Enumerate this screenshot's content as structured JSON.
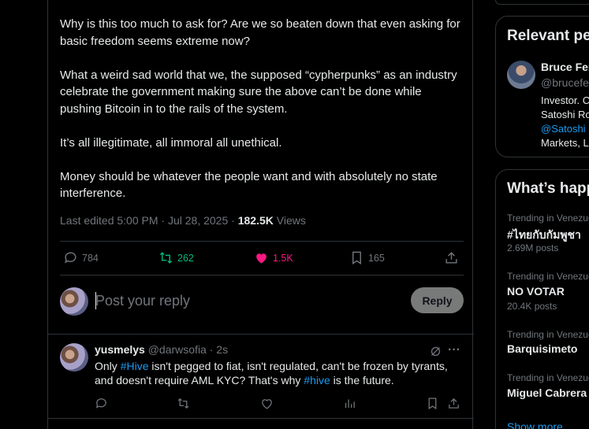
{
  "post": {
    "paragraphs": [
      "Why is this too much to ask for?  Are we so beaten down that even asking for basic freedom seems extreme now?",
      "What a weird sad world that we, the supposed “cypherpunks” as an industry celebrate the government making sure the above can’t be done while pushing Bitcoin in to the rails of the system.",
      "It’s all illegitimate, all immoral all unethical.",
      "Money should be whatever the people want and with absolutely no state interference."
    ],
    "meta": {
      "edited": "Last edited 5:00 PM · Jul 28, 2025 · ",
      "views_count": "182.5K",
      "views_label": " Views"
    },
    "actions": {
      "replies": "784",
      "reposts": "262",
      "likes": "1.5K",
      "bookmarks": "165"
    },
    "colors": {
      "repost": "#00ba7c",
      "like": "#f91880",
      "link": "#1d9bf0"
    }
  },
  "reply_box": {
    "placeholder": "Post your reply",
    "button": "Reply"
  },
  "comment": {
    "name": "yusmelys",
    "handle": " @darwsofia · 2s",
    "text_1": "Only ",
    "tag_1": "#Hive",
    "text_2": " isn't pegged to fiat, isn't regulated, can't be frozen by tyrants, and doesn't require AML KYC? That's why ",
    "tag_2": "#hive",
    "text_3": " is the future."
  },
  "sidebar": {
    "relevant": {
      "title": "Relevant pe",
      "name": "Bruce Fen",
      "handle": "@brucefen",
      "bio_lines": [
        "Investor. C",
        "Satoshi Ro",
        "@Satoshi",
        "Markets, L"
      ]
    },
    "trends": {
      "title": "What’s happ",
      "items": [
        {
          "meta": "Trending in Venezue",
          "name": "#ไทยกับกัมพูชา",
          "posts": "2.69M posts"
        },
        {
          "meta": "Trending in Venezue",
          "name": "NO VOTAR",
          "posts": "20.4K posts"
        },
        {
          "meta": "Trending in Venezue",
          "name": "Barquisimeto",
          "posts": ""
        },
        {
          "meta": "Trending in Venezue",
          "name": "Miguel Cabrera",
          "posts": ""
        }
      ],
      "show_more": "Show more"
    }
  }
}
